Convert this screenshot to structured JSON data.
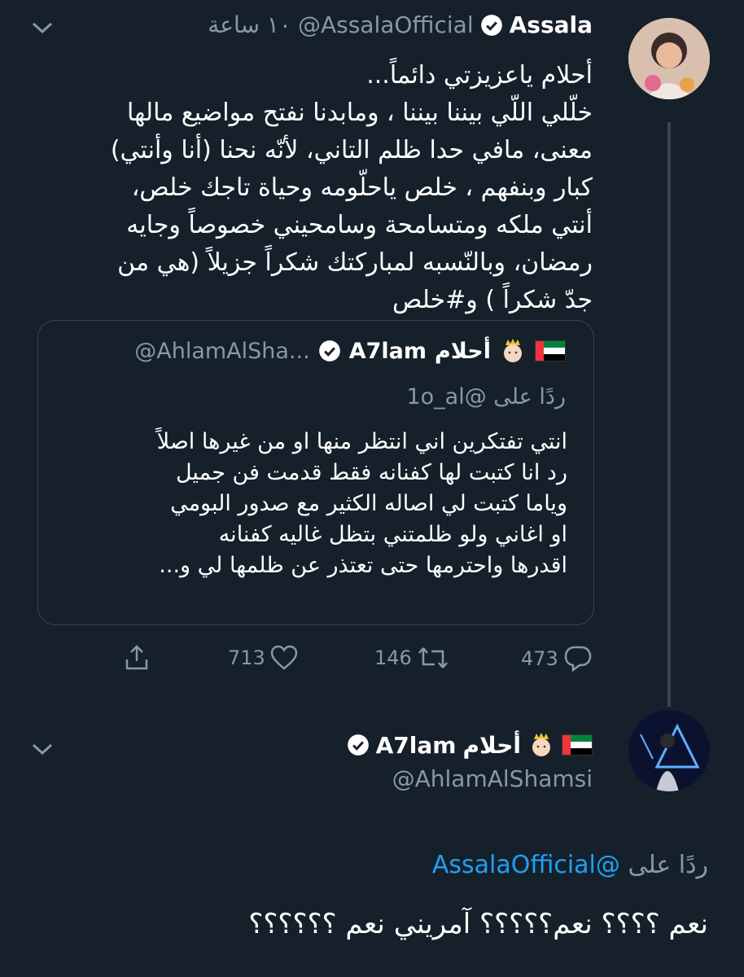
{
  "colors": {
    "background": "#15202b",
    "text": "#ffffff",
    "muted": "#8899a6",
    "link": "#1da1f2",
    "border": "#38444d",
    "verified": "#ffffff"
  },
  "tweet1": {
    "name": "Assala",
    "handle": "@AssalaOfficial",
    "time": "١٠ ساعة",
    "text": "أحلام ياعزيزتي دائماً...\nخلّلي اللّي بيننا بيننا ، ومابدنا نفتح مواضيع مالها\nمعنى، مافي حدا ظلم التاني، لأنّه نحنا (أنا وأنتي)\nكبار وبنفهم ، خلص ياحلّومه وحياة تاجك خلص،\nأنتي ملكه ومتسامحة وسامحيني خصوصاً وجايه\nرمضان، وبالنّسبه لمباركتك شكراً جزيلاً (هي من\nجدّ شكراً ) و#خلص",
    "avatar_icon": "woman-avatar",
    "quote": {
      "name_ar": "أحلام",
      "name_en": "A7lam",
      "handle": "@AhlamAlSha...",
      "flag_icon": "uae-flag",
      "crown_icon": "princess-emoji",
      "reply_prefix": "ردًا على",
      "reply_handle": "@1o_al",
      "text": "انتي تفتكرين اني انتظر منها او من غيرها اصلاً\nرد انا كتبت لها كفنانه فقط قدمت فن جميل\nوياما كتبت لي اصاله الكثير مع صدور البومي\nاو اغاني ولو ظلمتني بتظل غاليه كفنانه\nاقدرها واحترمها حتى تعتذر عن ظلمها لي و..."
    },
    "actions": {
      "replies": "473",
      "retweets": "146",
      "likes": "713"
    }
  },
  "tweet2": {
    "name_ar": "أحلام",
    "name_en": "A7lam",
    "handle": "@AhlamAlShamsi",
    "avatar_icon": "singer-avatar",
    "reply_prefix": "ردًا على",
    "reply_handle": "@AssalaOfficial",
    "text": "نعم ؟؟؟؟ نعم؟؟؟؟؟ آمريني نعم ؟؟؟؟؟؟"
  }
}
